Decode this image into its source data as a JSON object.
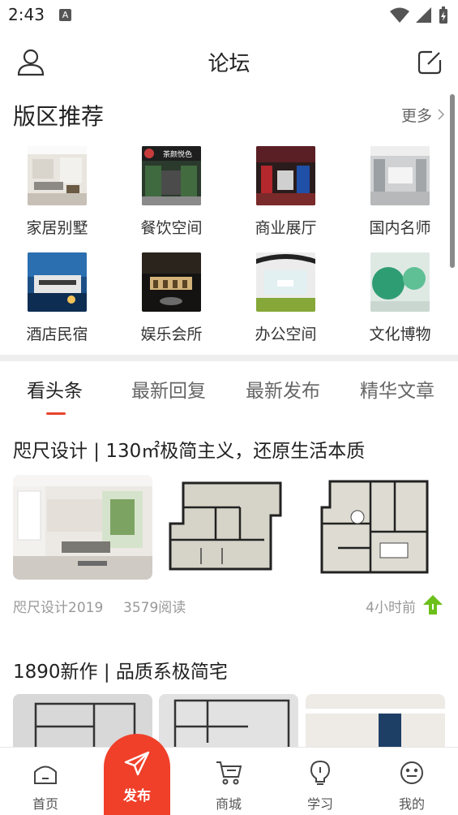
{
  "status_bar": {
    "time": "2:43",
    "a_badge": "A"
  },
  "header": {
    "title": "论坛"
  },
  "section": {
    "title": "版区推荐",
    "more": "更多"
  },
  "categories": [
    {
      "label": "家居别墅"
    },
    {
      "label": "餐饮空间",
      "logo_text": "茶颜悦色"
    },
    {
      "label": "商业展厅"
    },
    {
      "label": "国内名师"
    },
    {
      "label": "酒店民宿"
    },
    {
      "label": "娱乐会所"
    },
    {
      "label": "办公空间"
    },
    {
      "label": "文化博物"
    }
  ],
  "tabs": [
    {
      "label": "看头条",
      "active": true
    },
    {
      "label": "最新回复"
    },
    {
      "label": "最新发布"
    },
    {
      "label": "精华文章"
    }
  ],
  "posts": [
    {
      "title": "咫尺设计 | 130㎡极简主义，还原生活本质",
      "author": "咫尺设计2019",
      "reads": "3579阅读",
      "time": "4小时前"
    },
    {
      "title": "1890新作 | 品质系极简宅"
    }
  ],
  "bottom_nav": {
    "home": "首页",
    "publish": "发布",
    "mall": "商城",
    "learn": "学习",
    "mine": "我的"
  },
  "colors": {
    "accent": "#f0402a",
    "tab_underline": "#e8432b",
    "up_badge": "#6cc01a"
  },
  "icons": [
    "user-icon",
    "edit-icon",
    "chevron-right-icon",
    "arrow-up-icon",
    "home-icon",
    "send-icon",
    "cart-icon",
    "bulb-icon",
    "smile-icon"
  ]
}
